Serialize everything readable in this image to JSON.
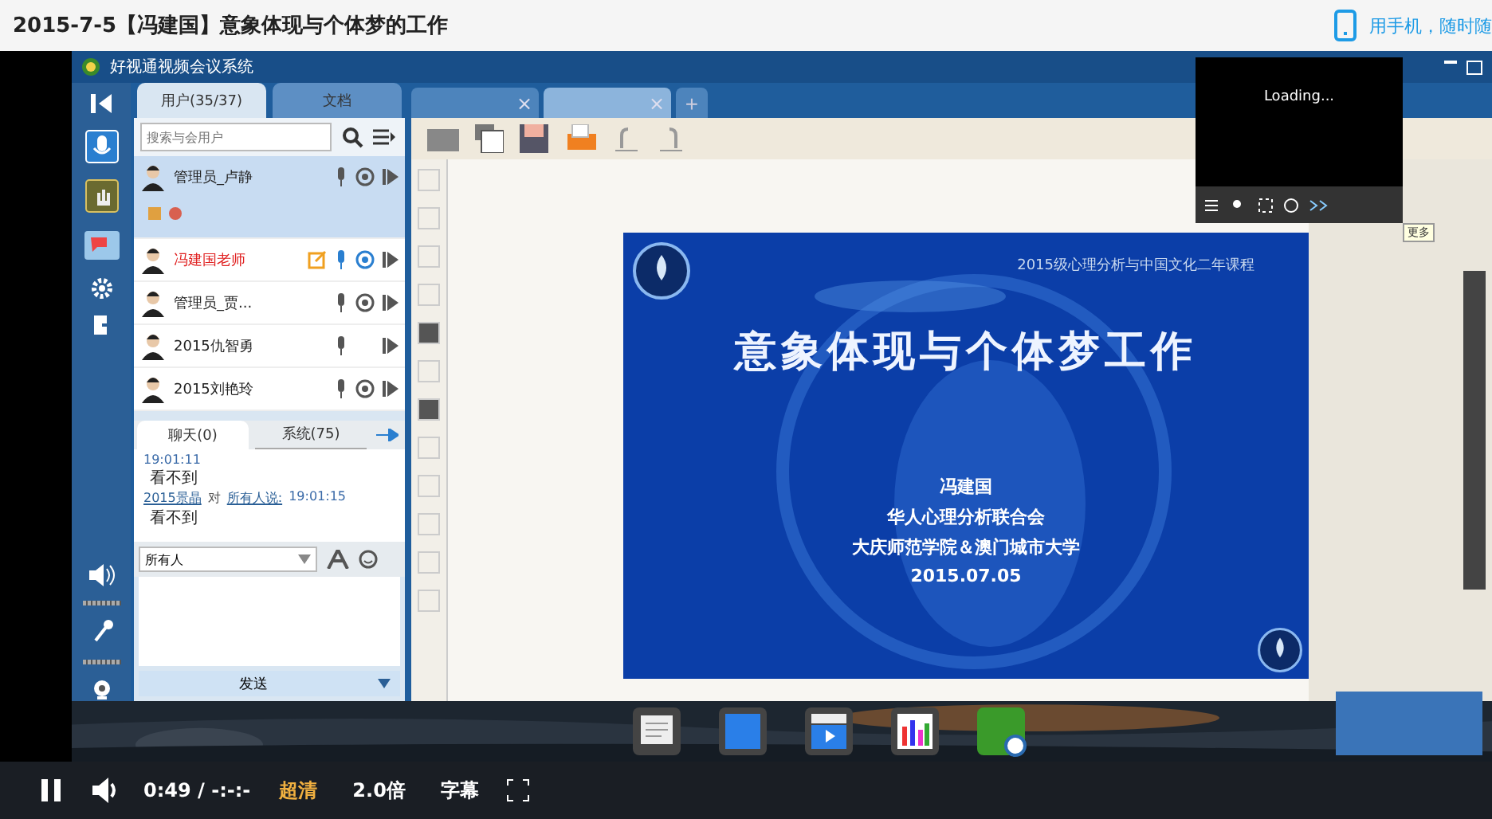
{
  "page": {
    "title": "2015-7-5【冯建国】意象体现与个体梦的工作",
    "mobile_link": "用手机，随时随"
  },
  "app": {
    "title": "好视通视频会议系统",
    "tabs": [
      {
        "label": "用户(35/37)",
        "selected": true
      },
      {
        "label": "文档",
        "selected": false
      }
    ],
    "search": {
      "placeholder": "搜索与会用户"
    },
    "users": [
      {
        "name": "管理员_卢静",
        "selected": true,
        "presenter": false,
        "camera": true
      },
      {
        "name": "冯建国老师",
        "selected": false,
        "presenter": true,
        "camera": true
      },
      {
        "name": "管理员_贾...",
        "selected": false,
        "presenter": false,
        "camera": true
      },
      {
        "name": "2015仇智勇",
        "selected": false,
        "presenter": false,
        "camera": false
      },
      {
        "name": "2015刘艳玲",
        "selected": false,
        "presenter": false,
        "camera": true
      }
    ],
    "chat_tabs": [
      {
        "label": "聊天(0)",
        "selected": true
      },
      {
        "label": "系统(75)",
        "selected": false
      }
    ],
    "messages": [
      {
        "time": "19:01:11",
        "text": "看不到"
      },
      {
        "sender": "2015景晶",
        "to": "对",
        "target": "所有人说:",
        "time": "19:01:15",
        "text": "看不到"
      }
    ],
    "recipient": "所有人",
    "send_button": "发送",
    "doc_tabs": [
      {
        "close": "×",
        "selected": false
      },
      {
        "close": "×",
        "selected": true
      }
    ],
    "add_tab": "+",
    "slide": {
      "course": "2015级心理分析与中国文化二年课程",
      "title": "意象体现与个体梦工作",
      "speaker": "冯建国",
      "org": "华人心理分析联合会",
      "schools": "大庆师范学院＆澳门城市大学",
      "date": "2015.07.05"
    },
    "preview": {
      "status": "Loading...",
      "tooltip": "更多"
    }
  },
  "player": {
    "playing": true,
    "time": "0:49",
    "separator": "/",
    "duration": "-:-:-",
    "quality": "超清",
    "speed": "2.0倍",
    "subtitles": "字幕"
  }
}
